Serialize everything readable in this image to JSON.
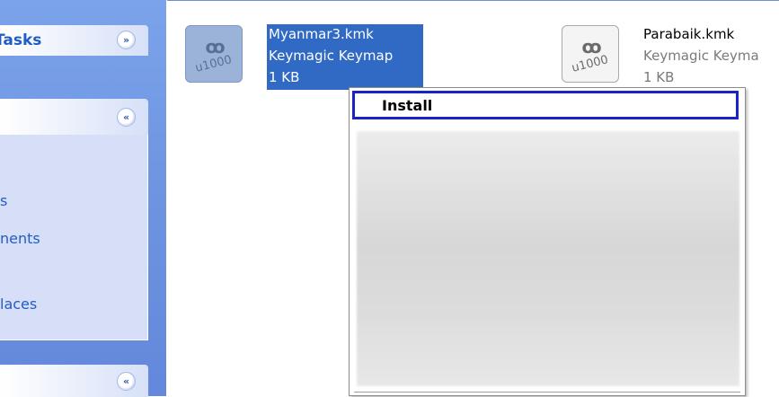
{
  "task_pane": {
    "groups": [
      {
        "title": "Tasks",
        "chevron": "»"
      },
      {
        "title": "",
        "chevron": "«",
        "links": [
          "s",
          "nents",
          "laces"
        ]
      },
      {
        "title": "",
        "chevron": "«"
      }
    ]
  },
  "files": [
    {
      "name": "Myanmar3.kmk",
      "type": "Keymagic Keymap",
      "size": "1 KB",
      "icon_code": "u1000",
      "icon_name": "keymagic-file-icon",
      "selected": true
    },
    {
      "name": "Parabaik.kmk",
      "type": "Keymagic Keyma",
      "size": "1 KB",
      "icon_code": "u1000",
      "icon_name": "keymagic-file-icon",
      "selected": false
    }
  ],
  "context_menu": {
    "items": [
      {
        "label": "Install",
        "focused": true
      }
    ]
  },
  "colors": {
    "selection_bg": "#316ac5",
    "task_link": "#215dc6",
    "task_pane_bg": "#6d92e0",
    "menu_focus_border": "#1a23c8"
  }
}
